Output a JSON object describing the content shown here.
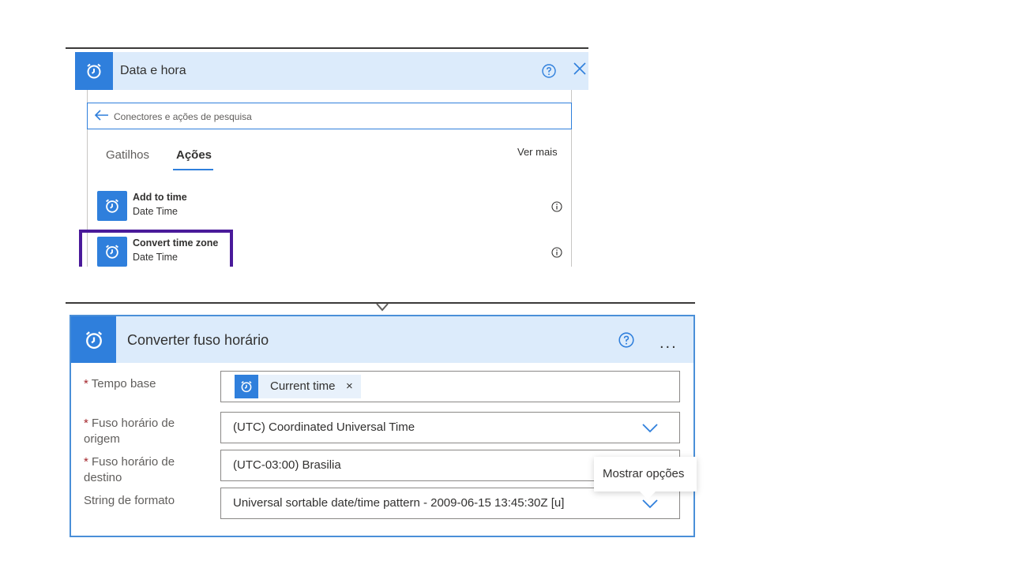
{
  "picker": {
    "title": "Data e hora",
    "search_placeholder": "Conectores e ações de pesquisa",
    "tabs": [
      {
        "label": "Gatilhos"
      },
      {
        "label": "Ações"
      }
    ],
    "see_more": "Ver mais",
    "actions": [
      {
        "title": "Add to time",
        "subtitle": "Date Time"
      },
      {
        "title": "Convert time zone",
        "subtitle": "Date Time"
      }
    ]
  },
  "card": {
    "title": "Converter fuso horário",
    "required_mark": "*",
    "fields": [
      {
        "label": "Tempo base",
        "token": "Current time",
        "token_remove": "×"
      },
      {
        "label": "Fuso horário de origem",
        "value": "(UTC) Coordinated Universal Time"
      },
      {
        "label": "Fuso horário de destino",
        "value": "(UTC-03:00) Brasilia"
      },
      {
        "label": "String de formato",
        "value": "Universal sortable date/time pattern - 2009-06-15 13:45:30Z [u]"
      }
    ],
    "tooltip": "Mostrar opções",
    "more_glyph": "..."
  },
  "colors": {
    "accent": "#2f7fdc",
    "header_bg": "#dcebfb",
    "highlight": "#4a1a9a",
    "required": "#a4262c"
  },
  "icons": [
    "alarm-clock-icon",
    "help-icon",
    "close-icon",
    "back-arrow-icon",
    "info-icon",
    "chevron-down-icon",
    "more-icon"
  ]
}
